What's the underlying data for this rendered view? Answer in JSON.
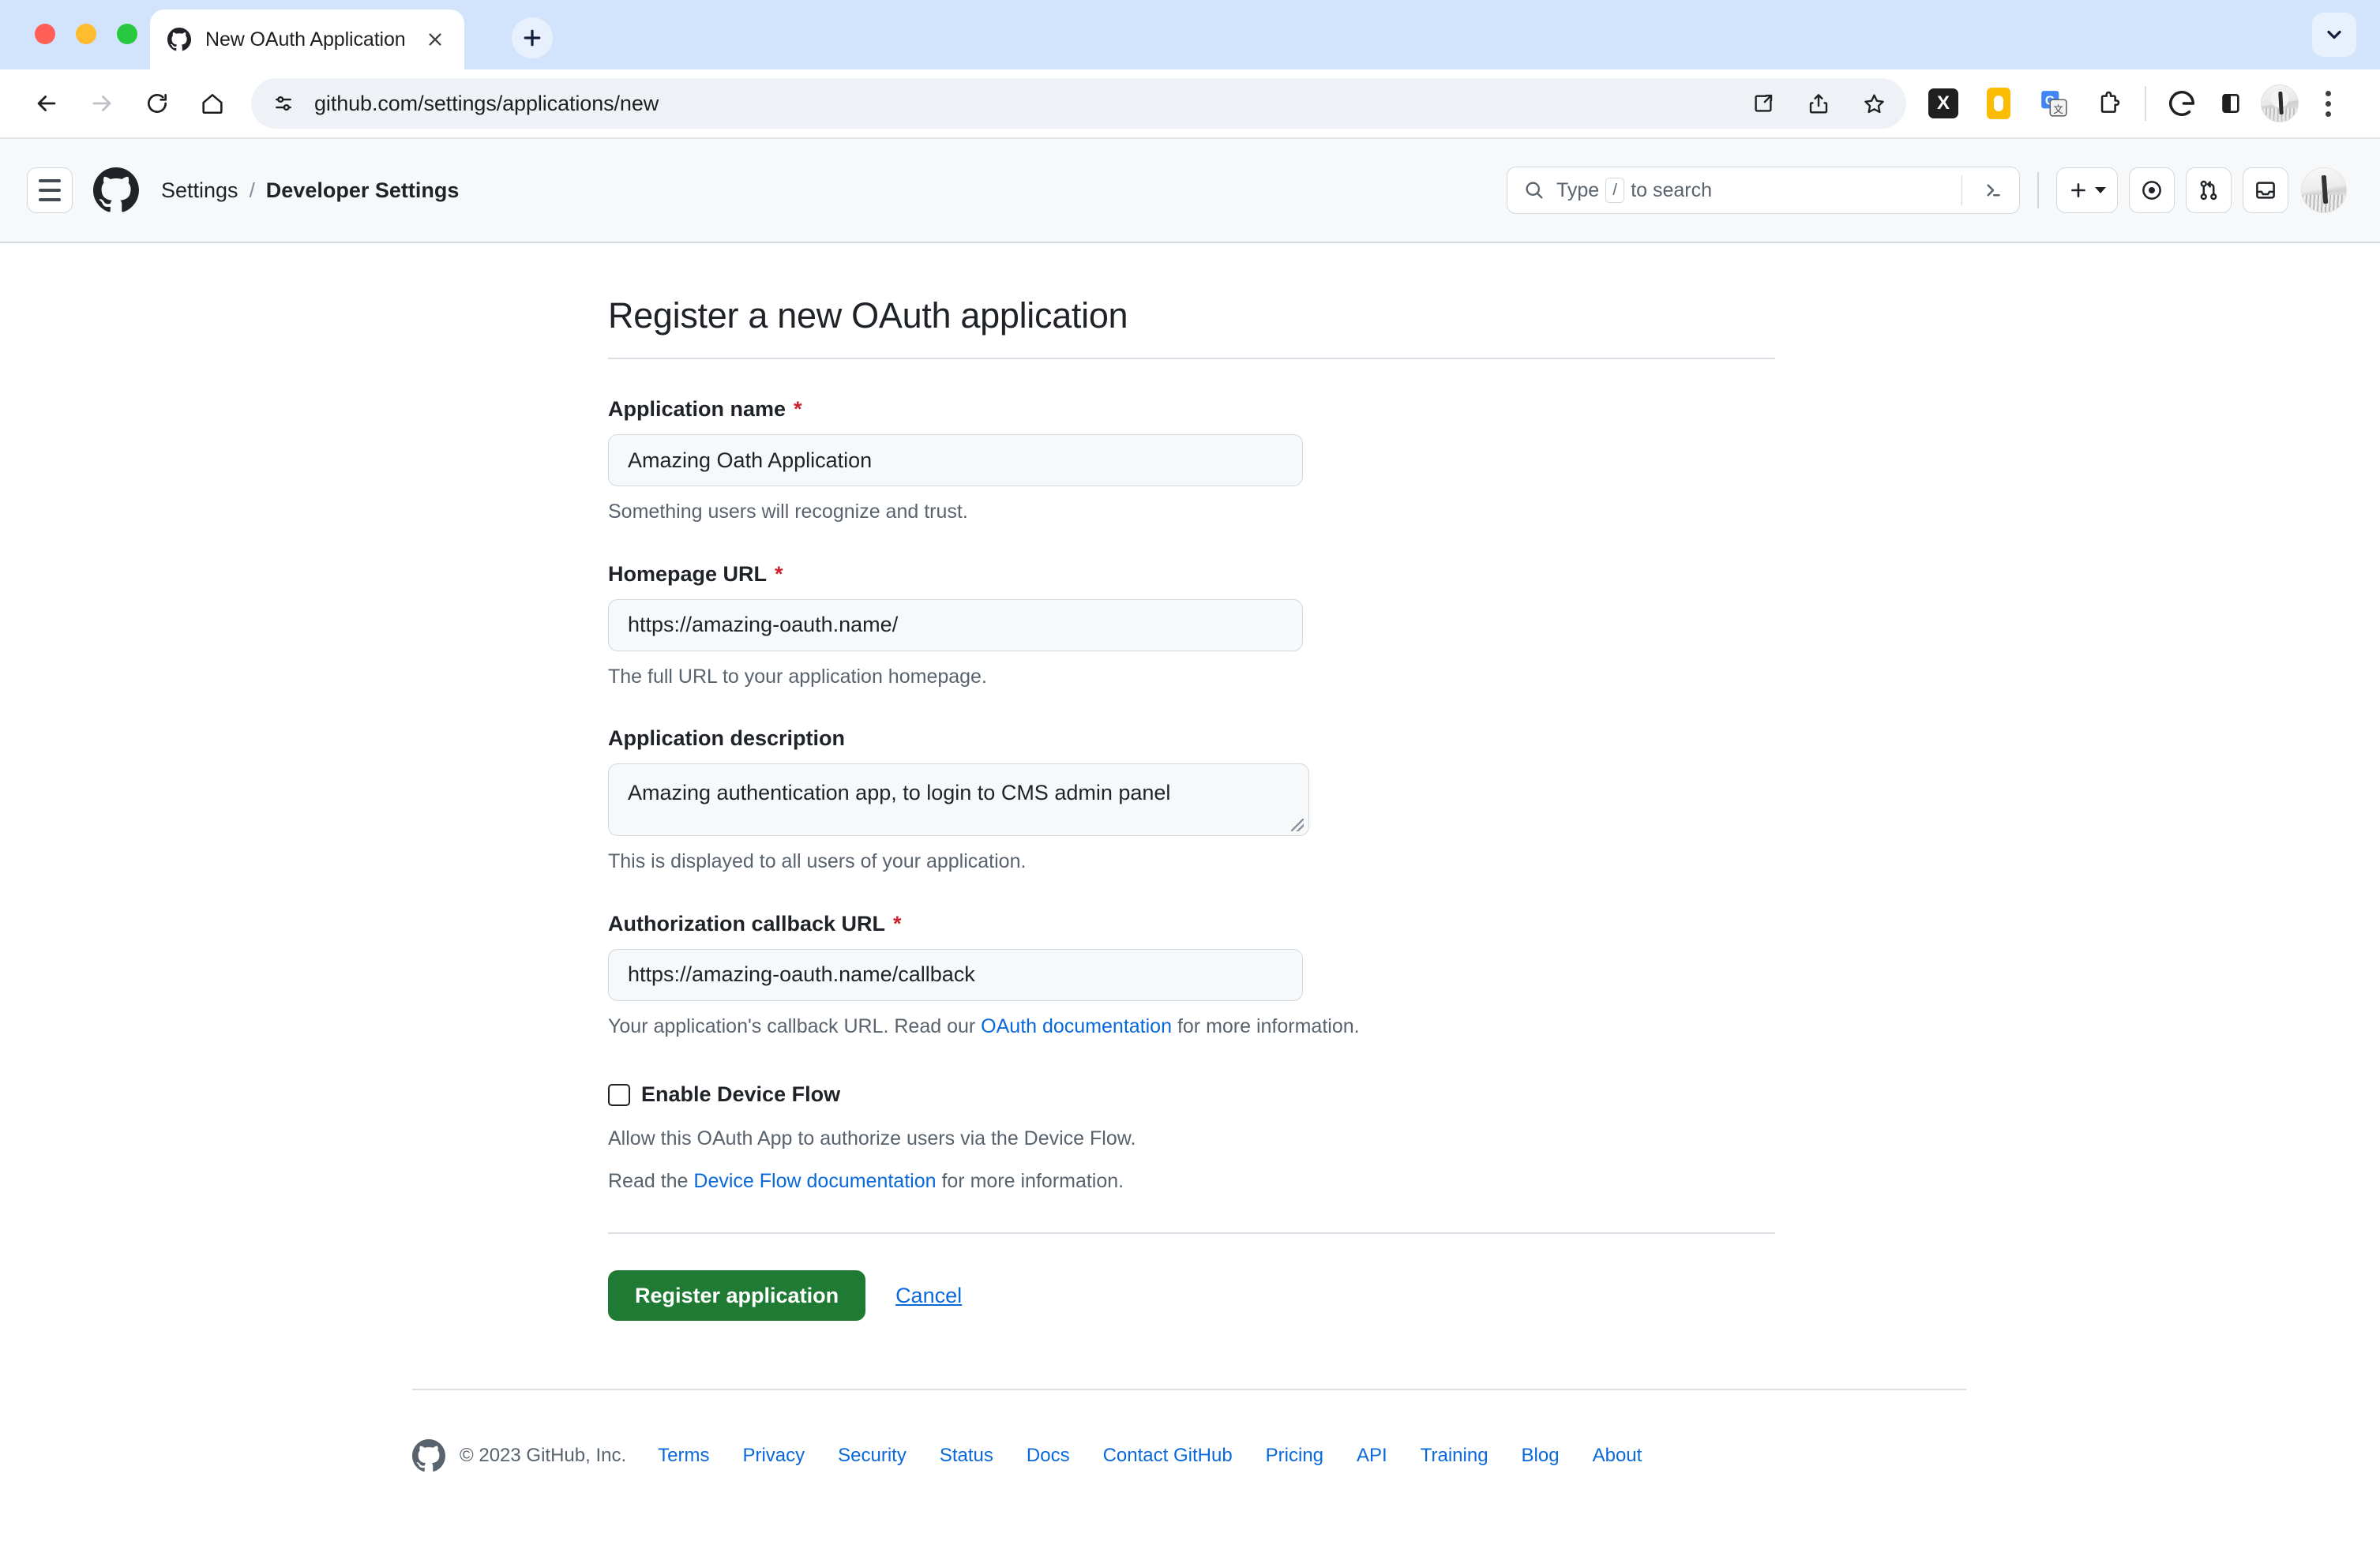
{
  "browser": {
    "tab": {
      "title": "New OAuth Application",
      "favicon_icon": "github-mark-icon",
      "close_icon": "close-icon"
    },
    "new_tab_icon": "plus-icon",
    "tabstrip_menu_icon": "chevron-down-icon",
    "nav": {
      "back_icon": "arrow-left-icon",
      "forward_icon": "arrow-right-icon",
      "reload_icon": "reload-icon",
      "home_icon": "home-icon"
    },
    "omnibox": {
      "site_settings_icon": "tune-sliders-icon",
      "url": "github.com/settings/applications/new",
      "open_in_app_icon": "open-in-new-icon",
      "share_icon": "share-icon",
      "bookmark_icon": "star-icon"
    },
    "extensions": [
      {
        "name": "extension-x-icon",
        "label": "X"
      },
      {
        "name": "extension-amber-icon",
        "label": ""
      },
      {
        "name": "google-translate-icon",
        "label": "G"
      },
      {
        "name": "extension-puzzle-icon",
        "label": ""
      }
    ],
    "profile": {
      "google_icon": "google-g-icon",
      "sidepanel_icon": "side-panel-icon",
      "avatar_icon": "profile-avatar",
      "menu_icon": "three-dots-menu-icon"
    }
  },
  "gh_header": {
    "hamburger_icon": "hamburger-menu-icon",
    "logo_icon": "github-mark-icon",
    "breadcrumb": {
      "root": "Settings",
      "separator": "/",
      "current": "Developer Settings"
    },
    "search": {
      "icon": "search-icon",
      "placeholder_prefix": "Type",
      "slash_key": "/",
      "placeholder_suffix": "to search",
      "command_palette_icon": "terminal-prompt-icon"
    },
    "actions": {
      "create_new_icon": "plus-icon",
      "create_new_caret_icon": "chevron-down-icon",
      "issues_icon": "issue-opened-icon",
      "pull_requests_icon": "git-pull-request-icon",
      "inbox_icon": "inbox-icon",
      "avatar_icon": "user-avatar"
    }
  },
  "main": {
    "title": "Register a new OAuth application",
    "fields": [
      {
        "label": "Application name",
        "required": true,
        "required_mark": "*",
        "value": "Amazing Oath Application",
        "note": "Something users will recognize and trust."
      },
      {
        "label": "Homepage URL",
        "required": true,
        "required_mark": "*",
        "value": "https://amazing-oauth.name/",
        "note": "The full URL to your application homepage."
      },
      {
        "label": "Application description",
        "required": false,
        "required_mark": "",
        "value": "Amazing authentication app, to login to CMS admin panel",
        "note": "This is displayed to all users of your application."
      },
      {
        "label": "Authorization callback URL",
        "required": true,
        "required_mark": "*",
        "value": "https://amazing-oauth.name/callback",
        "note_before_link": "Your application's callback URL. Read our ",
        "note_link": "OAuth documentation",
        "note_after_link": " for more information."
      }
    ],
    "device_flow": {
      "checkbox_label": "Enable Device Flow",
      "checked": false,
      "note_1": "Allow this OAuth App to authorize users via the Device Flow.",
      "note_2_before_link": "Read the ",
      "note_2_link": "Device Flow documentation",
      "note_2_after_link": " for more information."
    },
    "actions": {
      "submit_label": "Register application",
      "cancel_label": "Cancel"
    }
  },
  "footer": {
    "logo_icon": "github-mark-icon",
    "copyright": "© 2023 GitHub, Inc.",
    "links": [
      "Terms",
      "Privacy",
      "Security",
      "Status",
      "Docs",
      "Contact GitHub",
      "Pricing",
      "API",
      "Training",
      "Blog",
      "About"
    ]
  },
  "colors": {
    "tabstrip_bg": "#d2e3fc",
    "gh_header_bg": "#f6f8fa",
    "input_bg": "#f6f8fa",
    "border": "#d1d9e0",
    "link": "#0969da",
    "primary_button": "#1f7a33",
    "required_star": "#cf222e",
    "muted_text": "#59636e",
    "text": "#1f2328"
  }
}
